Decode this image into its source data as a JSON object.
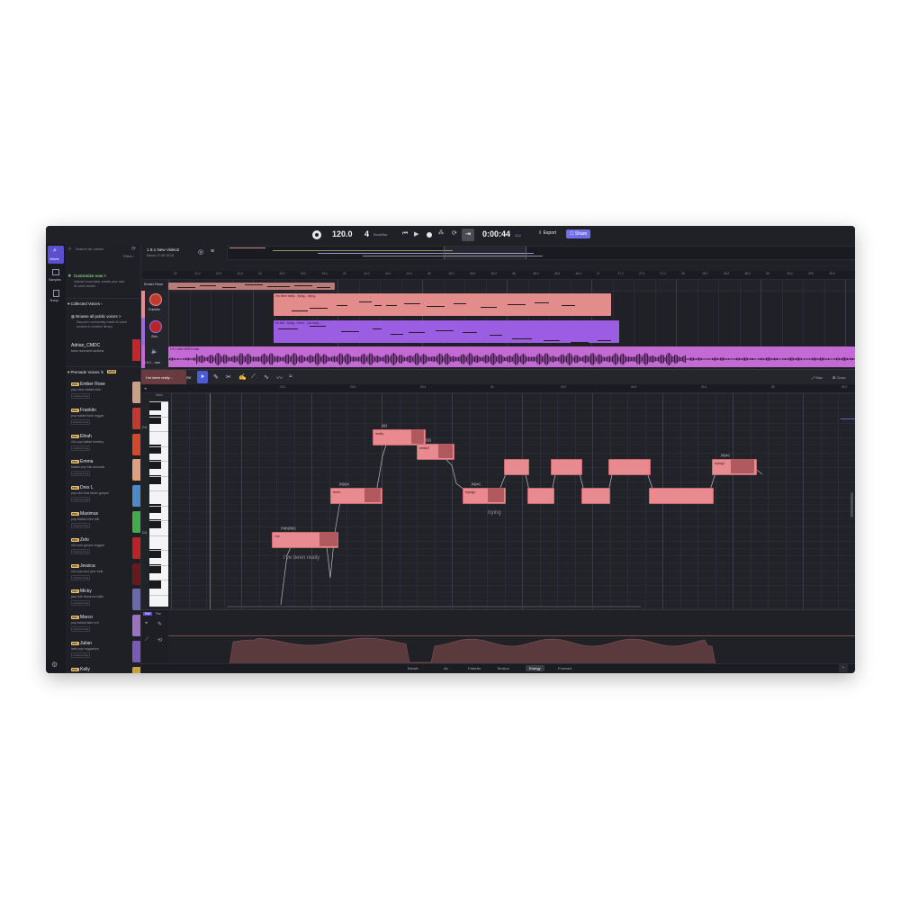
{
  "header": {
    "bpm": "120.0",
    "beats": "4",
    "beat_unit": "Beat/Bar",
    "time_main": "0:00:44",
    "time_frac": "312",
    "export_label": "Export",
    "share_label": "Share"
  },
  "project": {
    "title": "1.9.1 New Video2",
    "saved": "Saved 17:28 19:26"
  },
  "side_nav": [
    {
      "label": "Voices"
    },
    {
      "label": "Samples"
    },
    {
      "label": "Templ."
    }
  ],
  "search": {
    "placeholder": "Search for voices",
    "filters": "Filters"
  },
  "customize": {
    "title": "Customize now >",
    "desc": "Upload vocal data, create your own AI voice model."
  },
  "collected": {
    "header": "Collected Voices",
    "browse_title": "Browse all public voices >",
    "browse_desc": "Discover community-made AI voice models in creative library",
    "item_name": "Adrian_CMDC",
    "item_desc": "bass resonant baritone"
  },
  "premade": {
    "header": "Premade Voices",
    "new_badge": "NEW",
    "badge_text": "PRO",
    "license_text": "License Free",
    "voices": [
      {
        "name": "Ember Rose",
        "desc": "pop clear ballad edm",
        "color": "#c9a08a"
      },
      {
        "name": "Franklin",
        "desc": "pop ballad funk reggae",
        "color": "#c23a2e"
      },
      {
        "name": "Elirah",
        "desc": "r&b pop ballad breathy",
        "color": "#d04a2a"
      },
      {
        "name": "Emma",
        "desc": "ballad pop folk acoustic",
        "color": "#e2a07a"
      },
      {
        "name": "Drex L",
        "desc": "pop r&b funk blues gospel",
        "color": "#4a8ac8"
      },
      {
        "name": "Maximus",
        "desc": "pop ballad edm folk",
        "color": "#3fae4a"
      },
      {
        "name": "Zelo",
        "desc": "r&b soul gospel reggae",
        "color": "#b8242a"
      },
      {
        "name": "Jessica",
        "desc": "r&b pop soul jazz funk",
        "color": "#6a1820"
      },
      {
        "name": "Micky",
        "desc": "jazz folk flamenco latin",
        "color": "#6a6aa8"
      },
      {
        "name": "Marco",
        "desc": "pop ballad latin lo-fi",
        "color": "#9a72c4"
      },
      {
        "name": "Julian",
        "desc": "latin pop reggaeton",
        "color": "#7a5ab8"
      },
      {
        "name": "Kelly",
        "desc": "",
        "color": "#c8a040"
      }
    ]
  },
  "tracks": {
    "header_name": "Ember Rose",
    "items": [
      {
        "name": "Franklin"
      },
      {
        "name": "Zelo"
      },
      {
        "name": "1.9.1 ...ract"
      }
    ],
    "clip1_label": "I've been really... trying... trying...",
    "clip2_label": "I'm still... trying... been... you baby...",
    "audio_label": "1.9.1 with VIDEO main"
  },
  "ruler_top": [
    "22",
    "22.2",
    "22.3",
    "22.4",
    "23",
    "23.2",
    "23.3",
    "23.4",
    "24",
    "24.2",
    "24.3",
    "24.4",
    "25",
    "25.2",
    "25.3",
    "25.4",
    "26",
    "26.2",
    "26.3",
    "26.4",
    "27",
    "27.2",
    "27.3",
    "27.4",
    "28",
    "28.2",
    "28.3",
    "28.4",
    "29",
    "29.2",
    "29.3",
    "29.4"
  ],
  "editor": {
    "clip_title": "I've been really ...",
    "mode": "SV",
    "max_label": "Max",
    "close_label": "Close",
    "ruler": [
      "23.2",
      "23.3",
      "23.4",
      "24",
      "24.2",
      "24.3",
      "24.4",
      "25",
      "25.2"
    ],
    "oct_c4": "C4",
    "oct_c5": "C4",
    "track_tag": "Main"
  },
  "notes": [
    {
      "label": "I've",
      "phon": "[*a][v][b][ɪ]"
    },
    {
      "label": "been",
      "phon": "[b][ɪ][n]"
    },
    {
      "label": "really-",
      "phon": "[r][i]"
    },
    {
      "label": "really2",
      "phon": "[l][i]"
    },
    {
      "label": "trying#",
      "phon": "[tr][aɪ]"
    },
    {
      "label": "",
      "phon": ""
    },
    {
      "label": "",
      "phon": ""
    },
    {
      "label": "",
      "phon": ""
    },
    {
      "label": "",
      "phon": ""
    },
    {
      "label": "",
      "phon": ""
    },
    {
      "label": "",
      "phon": ""
    },
    {
      "label": "trying2",
      "phon": "[tr][aɪ]"
    },
    {
      "label": "",
      "phon": ""
    }
  ],
  "lyrics": {
    "l1": "I've been really",
    "l2": "trying"
  },
  "params": {
    "tabs": [
      "Breath",
      "Air",
      "Falsetto",
      "Tension",
      "Energy",
      "Formant"
    ],
    "active": "Energy",
    "tool_a": "Edit",
    "tool_b": "Pan"
  }
}
